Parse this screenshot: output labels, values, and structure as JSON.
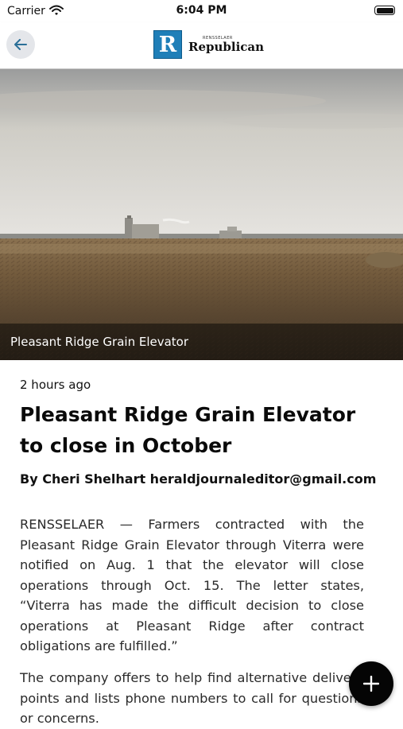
{
  "status_bar": {
    "carrier": "Carrier",
    "time": "6:04 PM"
  },
  "header": {
    "logo_letter": "R",
    "logo_small_text": "RENSSELAER",
    "logo_title": "Republican",
    "brand_color": "#1f7fb8"
  },
  "article": {
    "image_caption": "Pleasant Ridge Grain Elevator",
    "timestamp": "2 hours ago",
    "headline": "Pleasant Ridge Grain Elevator to close in October",
    "byline": "By Cheri Shelhart heraldjournaleditor@gmail.com",
    "paragraphs": [
      "RENSSELAER — Farmers contracted with the Pleasant Ridge Grain Elevator through Viterra were notified on Aug. 1 that the elevator will close operations through Oct. 15. The letter states, “Viterra has made the difficult decision to close operations at Pleasant Ridge after contract obligations are fulfilled.”",
      "The company offers to help find alternative delivery points and lists phone numbers to call for questions or concerns."
    ]
  },
  "icons": {
    "back": "arrow-left-icon",
    "fab": "plus-icon"
  }
}
